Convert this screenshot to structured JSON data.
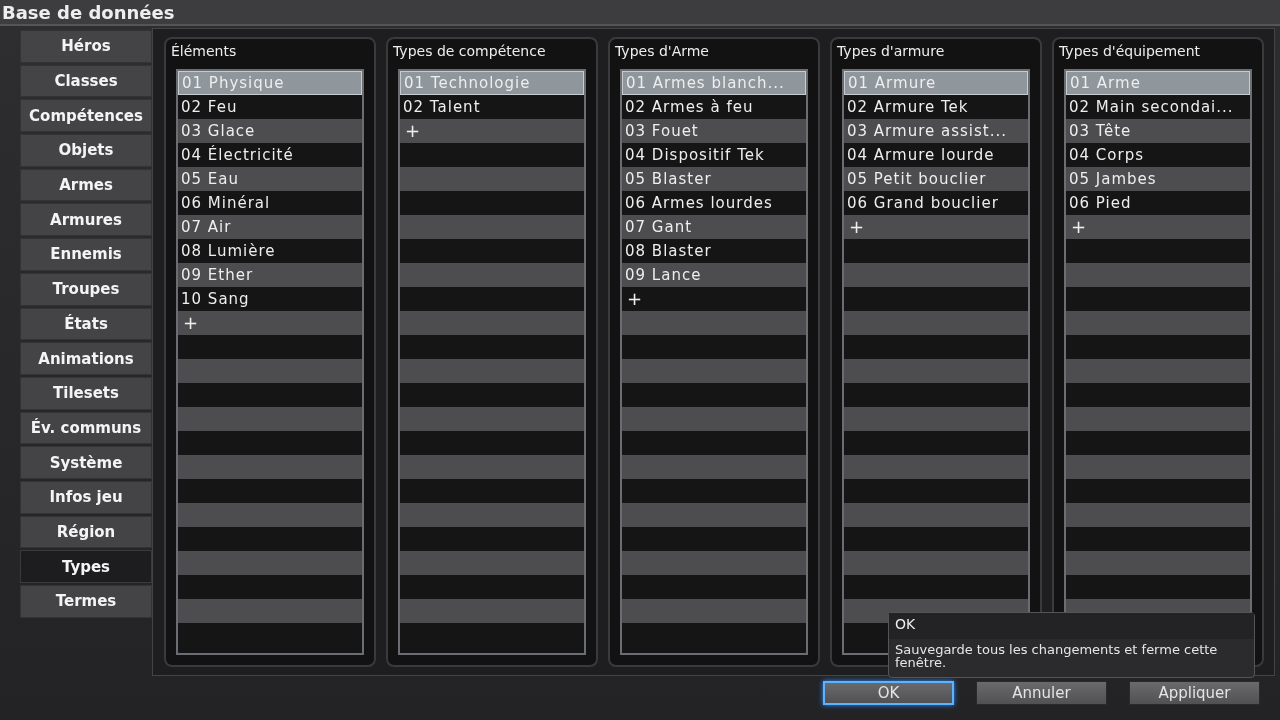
{
  "window": {
    "title": "Base de données"
  },
  "tabs": [
    {
      "label": "Héros",
      "selected": false
    },
    {
      "label": "Classes",
      "selected": false
    },
    {
      "label": "Compétences",
      "selected": false
    },
    {
      "label": "Objets",
      "selected": false
    },
    {
      "label": "Armes",
      "selected": false
    },
    {
      "label": "Armures",
      "selected": false
    },
    {
      "label": "Ennemis",
      "selected": false
    },
    {
      "label": "Troupes",
      "selected": false
    },
    {
      "label": "États",
      "selected": false
    },
    {
      "label": "Animations",
      "selected": false
    },
    {
      "label": "Tilesets",
      "selected": false
    },
    {
      "label": "Év. communs",
      "selected": false
    },
    {
      "label": "Système",
      "selected": false
    },
    {
      "label": "Infos jeu",
      "selected": false
    },
    {
      "label": "Région",
      "selected": false
    },
    {
      "label": "Types",
      "selected": true
    },
    {
      "label": "Termes",
      "selected": false
    }
  ],
  "groups": [
    {
      "title": "Éléments",
      "items": [
        {
          "kind": "entry",
          "text": "01 Physique",
          "selected": true
        },
        {
          "kind": "entry",
          "text": "02 Feu",
          "selected": false
        },
        {
          "kind": "entry",
          "text": "03 Glace",
          "selected": false
        },
        {
          "kind": "entry",
          "text": "04 Électricité",
          "selected": false
        },
        {
          "kind": "entry",
          "text": "05 Eau",
          "selected": false
        },
        {
          "kind": "entry",
          "text": "06 Minéral",
          "selected": false
        },
        {
          "kind": "entry",
          "text": "07 Air",
          "selected": false
        },
        {
          "kind": "entry",
          "text": "08 Lumière",
          "selected": false
        },
        {
          "kind": "entry",
          "text": "09 Ether",
          "selected": false
        },
        {
          "kind": "entry",
          "text": "10 Sang",
          "selected": false
        },
        {
          "kind": "add",
          "text": "+",
          "selected": false
        }
      ]
    },
    {
      "title": "Types de compétence",
      "items": [
        {
          "kind": "entry",
          "text": "01 Technologie",
          "selected": true
        },
        {
          "kind": "entry",
          "text": "02 Talent",
          "selected": false
        },
        {
          "kind": "add",
          "text": "+",
          "selected": false
        }
      ]
    },
    {
      "title": "Types d'Arme",
      "items": [
        {
          "kind": "entry",
          "text": "01 Armes blanch...",
          "selected": true
        },
        {
          "kind": "entry",
          "text": "02 Armes à feu",
          "selected": false
        },
        {
          "kind": "entry",
          "text": "03 Fouet",
          "selected": false
        },
        {
          "kind": "entry",
          "text": "04 Dispositif Tek",
          "selected": false
        },
        {
          "kind": "entry",
          "text": "05 Blaster",
          "selected": false
        },
        {
          "kind": "entry",
          "text": "06 Armes lourdes",
          "selected": false
        },
        {
          "kind": "entry",
          "text": "07 Gant",
          "selected": false
        },
        {
          "kind": "entry",
          "text": "08 Blaster",
          "selected": false
        },
        {
          "kind": "entry",
          "text": "09 Lance",
          "selected": false
        },
        {
          "kind": "add",
          "text": "+",
          "selected": false
        }
      ]
    },
    {
      "title": "Types d'armure",
      "items": [
        {
          "kind": "entry",
          "text": "01 Armure",
          "selected": true
        },
        {
          "kind": "entry",
          "text": "02 Armure Tek",
          "selected": false
        },
        {
          "kind": "entry",
          "text": "03 Armure assist...",
          "selected": false
        },
        {
          "kind": "entry",
          "text": "04 Armure lourde",
          "selected": false
        },
        {
          "kind": "entry",
          "text": "05 Petit bouclier",
          "selected": false
        },
        {
          "kind": "entry",
          "text": "06 Grand bouclier",
          "selected": false
        },
        {
          "kind": "add",
          "text": "+",
          "selected": false
        }
      ]
    },
    {
      "title": "Types d'équipement",
      "items": [
        {
          "kind": "entry",
          "text": "01 Arme",
          "selected": true
        },
        {
          "kind": "entry",
          "text": "02 Main secondai...",
          "selected": false
        },
        {
          "kind": "entry",
          "text": "03 Tête",
          "selected": false
        },
        {
          "kind": "entry",
          "text": "04 Corps",
          "selected": false
        },
        {
          "kind": "entry",
          "text": "05 Jambes",
          "selected": false
        },
        {
          "kind": "entry",
          "text": "06 Pied",
          "selected": false
        },
        {
          "kind": "add",
          "text": "+",
          "selected": false
        }
      ]
    }
  ],
  "tooltip": {
    "title": "OK",
    "text": "Sauvegarde tous les changements et ferme cette fenêtre."
  },
  "buttons": [
    {
      "label": "OK",
      "focused": true
    },
    {
      "label": "Annuler",
      "focused": false
    },
    {
      "label": "Appliquer",
      "focused": false
    }
  ]
}
